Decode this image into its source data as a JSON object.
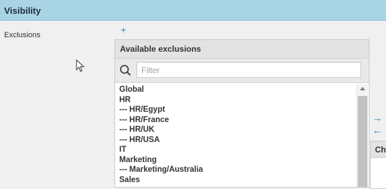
{
  "section": {
    "title": "Visibility"
  },
  "exclusions": {
    "label": "Exclusions",
    "add_icon": "plus-icon",
    "add_glyph": "+",
    "available": {
      "title": "Available exclusions",
      "search": {
        "placeholder": "Filter",
        "value": ""
      },
      "items": [
        "Global",
        "HR",
        "--- HR/Egypt",
        "--- HR/France",
        "--- HR/UK",
        "--- HR/USA",
        "IT",
        "Marketing",
        "--- Marketing/Australia",
        "Sales"
      ]
    },
    "move_right_glyph": "→",
    "move_left_glyph": "←",
    "chosen": {
      "title": "Ch"
    }
  },
  "colors": {
    "header_bg": "#a9d4e6",
    "accent": "#2b8fbd"
  }
}
